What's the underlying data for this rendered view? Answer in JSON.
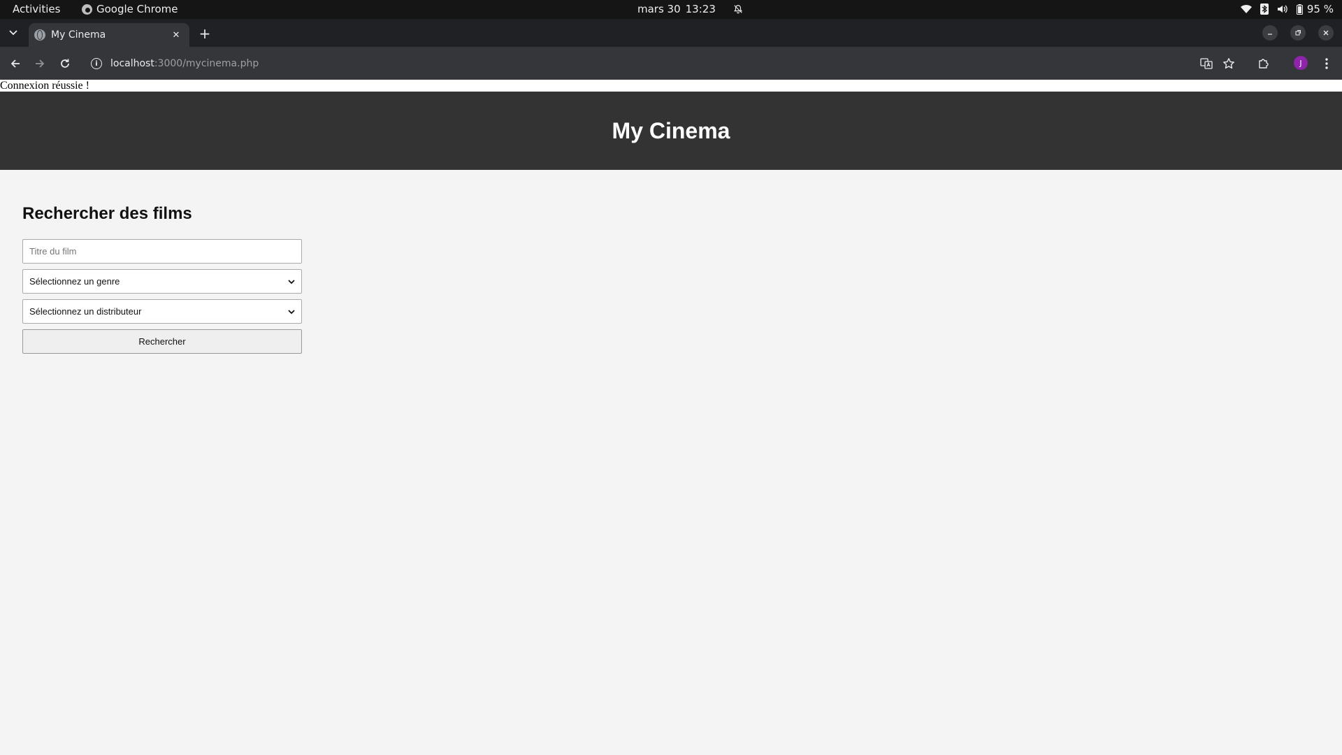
{
  "system_bar": {
    "activities_label": "Activities",
    "app_name": "Google Chrome",
    "date": "mars 30",
    "time": "13:23",
    "battery": "95 %"
  },
  "browser": {
    "tab_title": "My Cinema",
    "url_host": "localhost",
    "url_path": ":3000/mycinema.php",
    "profile_initial": "J"
  },
  "page": {
    "status_message": "Connexion réussie !",
    "site_title": "My Cinema",
    "search": {
      "heading": "Rechercher des films",
      "title_placeholder": "Titre du film",
      "genre_selected": "Sélectionnez un genre",
      "distributor_selected": "Sélectionnez un distributeur",
      "submit_label": "Rechercher"
    }
  },
  "colors": {
    "header_bg": "#333333",
    "page_bg": "#f4f4f4",
    "avatar_bg": "#8e24aa"
  }
}
